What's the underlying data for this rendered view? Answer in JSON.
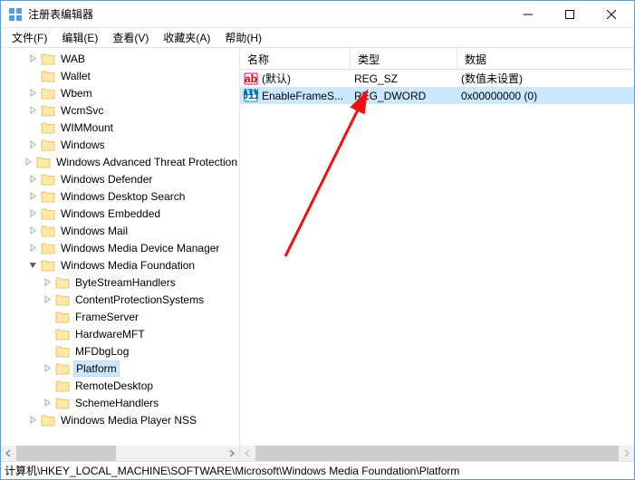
{
  "window": {
    "title": "注册表编辑器"
  },
  "menu": {
    "file": "文件(F)",
    "edit": "编辑(E)",
    "view": "查看(V)",
    "favorites": "收藏夹(A)",
    "help": "帮助(H)"
  },
  "tree": {
    "items": [
      {
        "label": "WAB",
        "indent": 0,
        "exp": "closed"
      },
      {
        "label": "Wallet",
        "indent": 0,
        "exp": "none"
      },
      {
        "label": "Wbem",
        "indent": 0,
        "exp": "closed"
      },
      {
        "label": "WcmSvc",
        "indent": 0,
        "exp": "closed"
      },
      {
        "label": "WIMMount",
        "indent": 0,
        "exp": "none"
      },
      {
        "label": "Windows",
        "indent": 0,
        "exp": "closed"
      },
      {
        "label": "Windows Advanced Threat Protection",
        "indent": 0,
        "exp": "closed"
      },
      {
        "label": "Windows Defender",
        "indent": 0,
        "exp": "closed"
      },
      {
        "label": "Windows Desktop Search",
        "indent": 0,
        "exp": "closed"
      },
      {
        "label": "Windows Embedded",
        "indent": 0,
        "exp": "closed"
      },
      {
        "label": "Windows Mail",
        "indent": 0,
        "exp": "closed"
      },
      {
        "label": "Windows Media Device Manager",
        "indent": 0,
        "exp": "closed"
      },
      {
        "label": "Windows Media Foundation",
        "indent": 0,
        "exp": "open"
      },
      {
        "label": "ByteStreamHandlers",
        "indent": 1,
        "exp": "closed"
      },
      {
        "label": "ContentProtectionSystems",
        "indent": 1,
        "exp": "closed"
      },
      {
        "label": "FrameServer",
        "indent": 1,
        "exp": "none"
      },
      {
        "label": "HardwareMFT",
        "indent": 1,
        "exp": "none"
      },
      {
        "label": "MFDbgLog",
        "indent": 1,
        "exp": "none"
      },
      {
        "label": "Platform",
        "indent": 1,
        "exp": "closed",
        "selected": true
      },
      {
        "label": "RemoteDesktop",
        "indent": 1,
        "exp": "none"
      },
      {
        "label": "SchemeHandlers",
        "indent": 1,
        "exp": "closed"
      },
      {
        "label": "Windows Media Player NSS",
        "indent": 0,
        "exp": "closed"
      }
    ]
  },
  "list": {
    "headers": {
      "name": "名称",
      "type": "类型",
      "data": "数据"
    },
    "rows": [
      {
        "icon": "string",
        "name": "(默认)",
        "type": "REG_SZ",
        "data": "(数值未设置)",
        "selected": false
      },
      {
        "icon": "binary",
        "name": "EnableFrameS...",
        "type": "REG_DWORD",
        "data": "0x00000000 (0)",
        "selected": true
      }
    ]
  },
  "statusbar": {
    "path": "计算机\\HKEY_LOCAL_MACHINE\\SOFTWARE\\Microsoft\\Windows Media Foundation\\Platform"
  }
}
